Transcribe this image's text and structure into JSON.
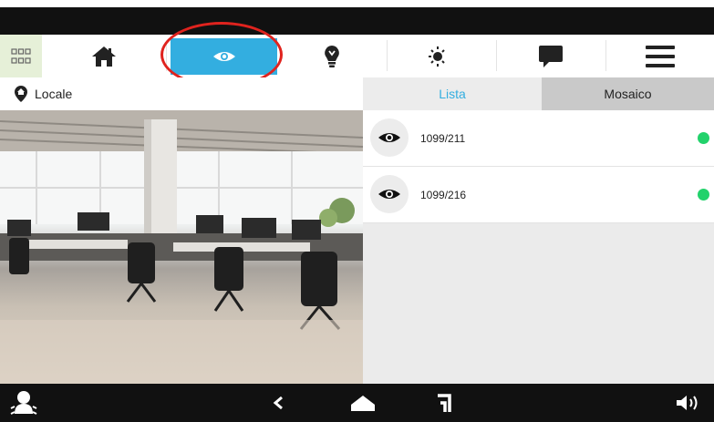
{
  "nav": {
    "items": [
      {
        "icon": "grid-icon"
      },
      {
        "icon": "home-icon"
      },
      {
        "icon": "eye-icon",
        "active": true
      },
      {
        "icon": "bulb-icon"
      },
      {
        "icon": "sun-moon-icon"
      },
      {
        "icon": "chat-icon"
      },
      {
        "icon": "menu-icon"
      }
    ],
    "active_color": "#33aee0",
    "highlight_color": "#e0231e"
  },
  "location": {
    "label": "Locale",
    "icon": "map-pin-icon"
  },
  "tabs": {
    "list_label": "Lista",
    "mosaic_label": "Mosaico",
    "active": "list"
  },
  "cameras": [
    {
      "id": "1099/211",
      "status_color": "#22d26b"
    },
    {
      "id": "1099/216",
      "status_color": "#22d26b"
    }
  ],
  "bottom_bar": {
    "items": [
      "doorbell-icon",
      "back-icon",
      "home-icon",
      "recent-icon",
      "volume-icon"
    ]
  }
}
